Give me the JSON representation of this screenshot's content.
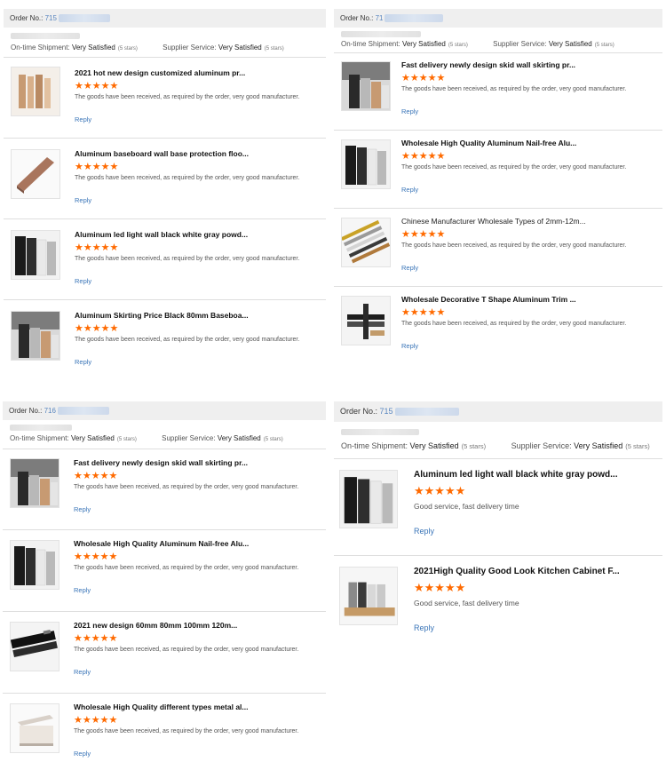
{
  "labels": {
    "order_prefix": "Order No.:",
    "ontime": "On-time Shipment:",
    "supplier": "Supplier Service:",
    "satisfied": "Very Satisfied",
    "five_stars": "(5 stars)",
    "reply": "Reply",
    "stars": "★★★★★"
  },
  "colors": {
    "star": "#ff6a00",
    "link": "#3a75b8",
    "bar": "#efefef"
  },
  "panels": [
    {
      "order_no": "715",
      "items": [
        {
          "title": "2021 hot new design customized aluminum pr...",
          "comment": "The goods have been received, as required by the order, very good manufacturer.",
          "image": "wood-profiles"
        },
        {
          "title": "Aluminum baseboard wall base protection floo...",
          "comment": "The goods have been received, as required by the order, very good manufacturer.",
          "image": "bronze-strip"
        },
        {
          "title": "Aluminum led light wall black white gray powd...",
          "comment": "The goods have been received, as required by the order, very good manufacturer.",
          "image": "color-panels"
        },
        {
          "title": "Aluminum Skirting Price Black 80mm Baseboa...",
          "comment": "The goods have been received, as required by the order, very good manufacturer.",
          "image": "skirting-samples"
        }
      ]
    },
    {
      "order_no": "71",
      "items": [
        {
          "title": "Fast delivery newly design skid wall skirting pr...",
          "comment": "The goods have been received, as required by the order, very good manufacturer.",
          "image": "skirting-samples"
        },
        {
          "title": "Wholesale High Quality Aluminum Nail-free Alu...",
          "comment": "The goods have been received, as required by the order, very good manufacturer.",
          "image": "color-panels"
        },
        {
          "title": "Chinese Manufacturer Wholesale Types of 2mm-12m...",
          "comment": "The goods have been received, as required by the order, very good manufacturer.",
          "image": "tile-trims"
        },
        {
          "title": "Wholesale Decorative T Shape Aluminum Trim ...",
          "comment": "The goods have been received, as required by the order, very good manufacturer.",
          "image": "t-trims"
        }
      ]
    },
    {
      "order_no": "716",
      "items": [
        {
          "title": "Fast delivery newly design skid wall skirting pr...",
          "comment": "The goods have been received, as required by the order, very good manufacturer.",
          "image": "skirting-samples"
        },
        {
          "title": "Wholesale High Quality Aluminum Nail-free Alu...",
          "comment": "The goods have been received, as required by the order, very good manufacturer.",
          "image": "color-panels"
        },
        {
          "title": "2021 new design 60mm 80mm 100mm 120m...",
          "comment": "The goods have been received, as required by the order, very good manufacturer.",
          "image": "black-profile"
        },
        {
          "title": "Wholesale High Quality different types metal al...",
          "comment": "The goods have been received, as required by the order, very good manufacturer.",
          "image": "white-profile"
        }
      ]
    },
    {
      "order_no": "715",
      "items": [
        {
          "title": "Aluminum led light wall black white gray powd...",
          "comment": "Good service, fast delivery time",
          "image": "color-panels"
        },
        {
          "title": "2021High Quality Good Look Kitchen Cabinet F...",
          "comment": "Good service, fast delivery time",
          "image": "cabinet-samples"
        }
      ]
    }
  ]
}
